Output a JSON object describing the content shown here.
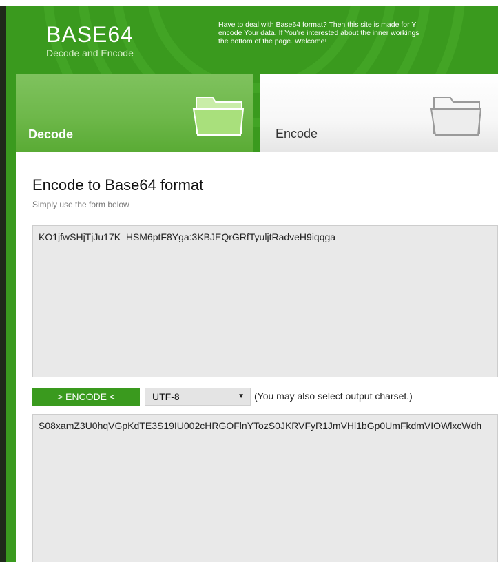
{
  "header": {
    "logo_title": "BASE64",
    "logo_subtitle": "Decode and Encode",
    "intro_lines": [
      "Have to deal with Base64 format? Then this site is made for Y",
      "encode Your data. If You're interested about the inner workings",
      "the bottom of the page. Welcome!"
    ]
  },
  "tabs": {
    "decode_label": "Decode",
    "encode_label": "Encode",
    "active": "Encode"
  },
  "panel": {
    "title": "Encode to Base64 format",
    "subtitle": "Simply use the form below",
    "input_value": "KO1jfwSHjTjJu17K_HSM6ptF8Yga:3KBJEQrGRfTyuljtRadveH9iqqga",
    "encode_button_label": "> ENCODE <",
    "charset_selected": "UTF-8",
    "charset_note": "(You may also select output charset.)",
    "output_value": "S08xamZ3U0hqVGpKdTE3S19IU002cHRGOFlnYTozS0JKRVFyR1JmVHl1bGp0UmFkdmVIOWlxcWdh"
  },
  "colors": {
    "brand_green": "#3a9a1e",
    "decode_tab_green": "#6eb84a",
    "field_gray": "#e9e9e9"
  },
  "icons": {
    "decode_folder": "folder-icon",
    "encode_folder": "folder-icon",
    "charset_arrow": "triangle-down-icon"
  }
}
